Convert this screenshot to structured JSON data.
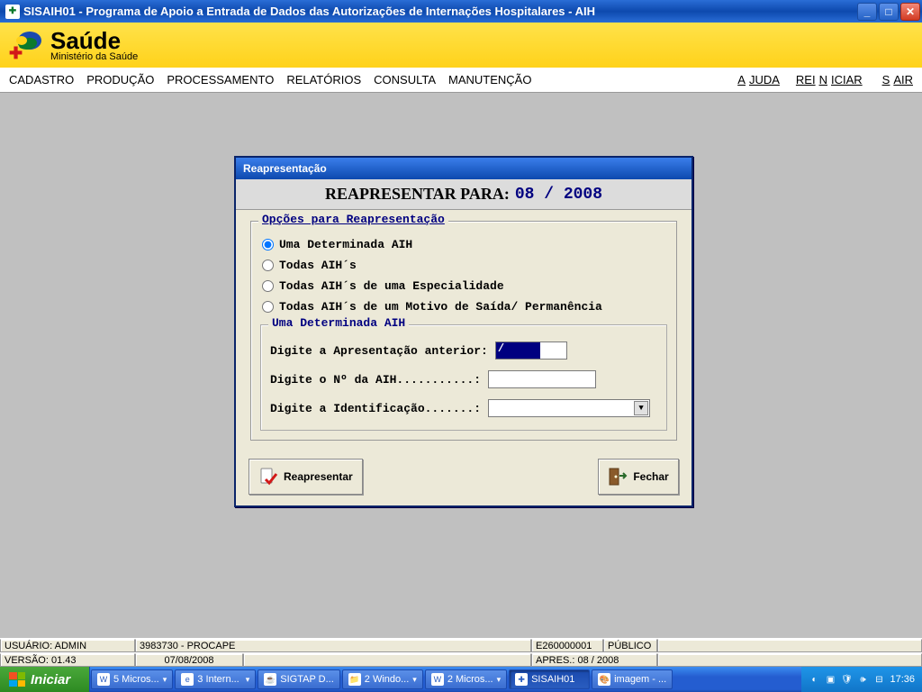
{
  "window": {
    "title": "SISAIH01  - Programa de Apoio a Entrada de Dados das Autorizações de Internações Hospitalares - AIH",
    "app_icon_glyph": "✚"
  },
  "banner": {
    "title": "Saúde",
    "subtitle": "Ministério da Saúde"
  },
  "menubar": {
    "items": [
      "CADASTRO",
      "PRODUÇÃO",
      "PROCESSAMENTO",
      "RELATÓRIOS",
      "CONSULTA",
      "MANUTENÇÃO"
    ],
    "right_items": [
      "AJUDA",
      "REINICIAR",
      "SAIR"
    ]
  },
  "dialog": {
    "title": "Reapresentação",
    "header_label": "REAPRESENTAR PARA:",
    "period_text": "08 / 2008",
    "group1_legend": "Opções para Reapresentação",
    "radios": {
      "r1": "Uma Determinada AIH",
      "r2": "Todas AIH´s",
      "r3": "Todas AIH´s de uma Especialidade",
      "r4": "Todas AIH´s de um Motivo de Saída/ Permanência"
    },
    "selected_radio": "r1",
    "group2_legend": "Uma Determinada AIH",
    "field1_label": "Digite a Apresentação anterior:",
    "field1_value": "   /",
    "field2_label": "Digite o Nº da AIH...........:",
    "field2_value": "",
    "field3_label": "Digite a Identificação.......:",
    "field3_value": "",
    "btn_reapresentar": "Reapresentar",
    "btn_fechar": "Fechar"
  },
  "statusbar": {
    "usuario_label": "USUÁRIO: ADMIN",
    "entidade": "3983730 - PROCAPE",
    "cnes": "E260000001",
    "acesso": "PÚBLICO",
    "versao_label": "VERSÃO: 01.43",
    "data": "07/08/2008",
    "apres_label": "APRES.: 08 / 2008"
  },
  "taskbar": {
    "start": "Iniciar",
    "items": [
      {
        "icon": "W",
        "label": "5 Micros...",
        "arrow": true
      },
      {
        "icon": "e",
        "label": "3 Intern...",
        "arrow": true
      },
      {
        "icon": "☕",
        "label": "SIGTAP D..."
      },
      {
        "icon": "📁",
        "label": "2 Windo...",
        "arrow": true
      },
      {
        "icon": "W",
        "label": "2 Micros...",
        "arrow": true
      },
      {
        "icon": "✚",
        "label": "SISAIH01",
        "active": true
      },
      {
        "icon": "🎨",
        "label": "imagem - ..."
      }
    ],
    "clock": "17:36"
  }
}
